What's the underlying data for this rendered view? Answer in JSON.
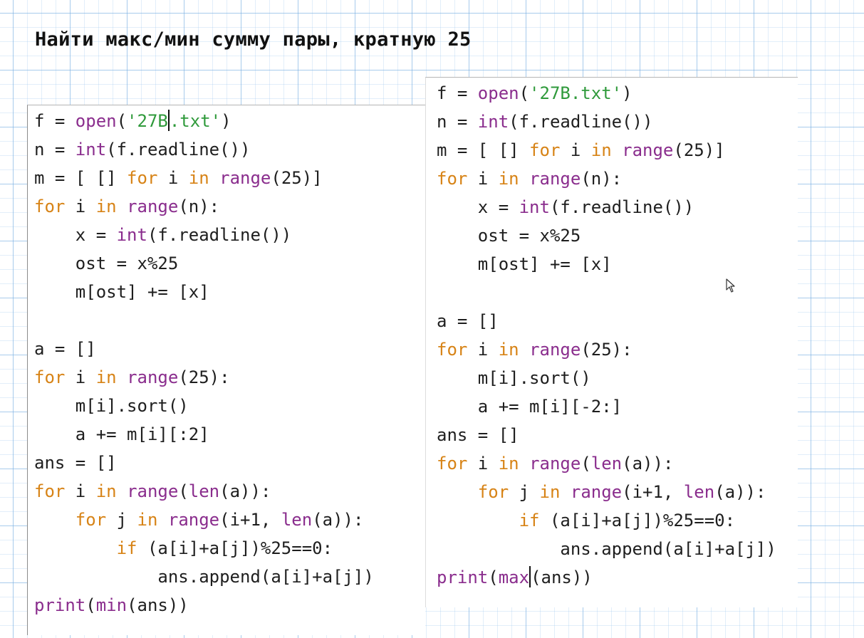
{
  "title": "Найти макс/мин сумму пары, кратную 25",
  "colors": {
    "keyword": "#d78316",
    "builtin": "#8a2d8d",
    "string": "#2f9a3b",
    "text": "#1e1e1e",
    "grid": "#78afe1"
  },
  "left_code": {
    "lines": [
      [
        {
          "t": "f = ",
          "c": "pl"
        },
        {
          "t": "open",
          "c": "bi"
        },
        {
          "t": "(",
          "c": "pl"
        },
        {
          "t": "'27B",
          "c": "str"
        },
        {
          "cursor": true
        },
        {
          "t": ".txt'",
          "c": "str"
        },
        {
          "t": ")",
          "c": "pl"
        }
      ],
      [
        {
          "t": "n = ",
          "c": "pl"
        },
        {
          "t": "int",
          "c": "bi"
        },
        {
          "t": "(f.readline())",
          "c": "pl"
        }
      ],
      [
        {
          "t": "m = [ [] ",
          "c": "pl"
        },
        {
          "t": "for",
          "c": "kw"
        },
        {
          "t": " i ",
          "c": "pl"
        },
        {
          "t": "in",
          "c": "kw"
        },
        {
          "t": " ",
          "c": "pl"
        },
        {
          "t": "range",
          "c": "bi"
        },
        {
          "t": "(25)]",
          "c": "pl"
        }
      ],
      [
        {
          "t": "for",
          "c": "kw"
        },
        {
          "t": " i ",
          "c": "pl"
        },
        {
          "t": "in",
          "c": "kw"
        },
        {
          "t": " ",
          "c": "pl"
        },
        {
          "t": "range",
          "c": "bi"
        },
        {
          "t": "(n):",
          "c": "pl"
        }
      ],
      [
        {
          "t": "    x = ",
          "c": "pl"
        },
        {
          "t": "int",
          "c": "bi"
        },
        {
          "t": "(f.readline())",
          "c": "pl"
        }
      ],
      [
        {
          "t": "    ost = x%25",
          "c": "pl"
        }
      ],
      [
        {
          "t": "    m[ost] += [x]",
          "c": "pl"
        }
      ],
      [],
      [
        {
          "t": "a = []",
          "c": "pl"
        }
      ],
      [
        {
          "t": "for",
          "c": "kw"
        },
        {
          "t": " i ",
          "c": "pl"
        },
        {
          "t": "in",
          "c": "kw"
        },
        {
          "t": " ",
          "c": "pl"
        },
        {
          "t": "range",
          "c": "bi"
        },
        {
          "t": "(25):",
          "c": "pl"
        }
      ],
      [
        {
          "t": "    m[i].sort()",
          "c": "pl"
        }
      ],
      [
        {
          "t": "    a += m[i][:2]",
          "c": "pl"
        }
      ],
      [
        {
          "t": "ans = []",
          "c": "pl"
        }
      ],
      [
        {
          "t": "for",
          "c": "kw"
        },
        {
          "t": " i ",
          "c": "pl"
        },
        {
          "t": "in",
          "c": "kw"
        },
        {
          "t": " ",
          "c": "pl"
        },
        {
          "t": "range",
          "c": "bi"
        },
        {
          "t": "(",
          "c": "pl"
        },
        {
          "t": "len",
          "c": "bi"
        },
        {
          "t": "(a)):",
          "c": "pl"
        }
      ],
      [
        {
          "t": "    ",
          "c": "pl"
        },
        {
          "t": "for",
          "c": "kw"
        },
        {
          "t": " j ",
          "c": "pl"
        },
        {
          "t": "in",
          "c": "kw"
        },
        {
          "t": " ",
          "c": "pl"
        },
        {
          "t": "range",
          "c": "bi"
        },
        {
          "t": "(i+1, ",
          "c": "pl"
        },
        {
          "t": "len",
          "c": "bi"
        },
        {
          "t": "(a)):",
          "c": "pl"
        }
      ],
      [
        {
          "t": "        ",
          "c": "pl"
        },
        {
          "t": "if",
          "c": "kw"
        },
        {
          "t": " (a[i]+a[j])%25==0:",
          "c": "pl"
        }
      ],
      [
        {
          "t": "            ans.append(a[i]+a[j])",
          "c": "pl"
        }
      ],
      [
        {
          "t": "print",
          "c": "bi"
        },
        {
          "t": "(",
          "c": "pl"
        },
        {
          "t": "min",
          "c": "bi"
        },
        {
          "t": "(ans))",
          "c": "pl"
        }
      ]
    ]
  },
  "right_code": {
    "lines": [
      [
        {
          "t": "f = ",
          "c": "pl"
        },
        {
          "t": "open",
          "c": "bi"
        },
        {
          "t": "(",
          "c": "pl"
        },
        {
          "t": "'27B.txt'",
          "c": "str"
        },
        {
          "t": ")",
          "c": "pl"
        }
      ],
      [
        {
          "t": "n = ",
          "c": "pl"
        },
        {
          "t": "int",
          "c": "bi"
        },
        {
          "t": "(f.readline())",
          "c": "pl"
        }
      ],
      [
        {
          "t": "m = [ [] ",
          "c": "pl"
        },
        {
          "t": "for",
          "c": "kw"
        },
        {
          "t": " i ",
          "c": "pl"
        },
        {
          "t": "in",
          "c": "kw"
        },
        {
          "t": " ",
          "c": "pl"
        },
        {
          "t": "range",
          "c": "bi"
        },
        {
          "t": "(25)]",
          "c": "pl"
        }
      ],
      [
        {
          "t": "for",
          "c": "kw"
        },
        {
          "t": " i ",
          "c": "pl"
        },
        {
          "t": "in",
          "c": "kw"
        },
        {
          "t": " ",
          "c": "pl"
        },
        {
          "t": "range",
          "c": "bi"
        },
        {
          "t": "(n):",
          "c": "pl"
        }
      ],
      [
        {
          "t": "    x = ",
          "c": "pl"
        },
        {
          "t": "int",
          "c": "bi"
        },
        {
          "t": "(f.readline())",
          "c": "pl"
        }
      ],
      [
        {
          "t": "    ost = x%25",
          "c": "pl"
        }
      ],
      [
        {
          "t": "    m[ost] += [x]",
          "c": "pl"
        }
      ],
      [],
      [
        {
          "t": "a = []",
          "c": "pl"
        }
      ],
      [
        {
          "t": "for",
          "c": "kw"
        },
        {
          "t": " i ",
          "c": "pl"
        },
        {
          "t": "in",
          "c": "kw"
        },
        {
          "t": " ",
          "c": "pl"
        },
        {
          "t": "range",
          "c": "bi"
        },
        {
          "t": "(25):",
          "c": "pl"
        }
      ],
      [
        {
          "t": "    m[i].sort()",
          "c": "pl"
        }
      ],
      [
        {
          "t": "    a += m[i][-2:]",
          "c": "pl"
        }
      ],
      [
        {
          "t": "ans = []",
          "c": "pl"
        }
      ],
      [
        {
          "t": "for",
          "c": "kw"
        },
        {
          "t": " i ",
          "c": "pl"
        },
        {
          "t": "in",
          "c": "kw"
        },
        {
          "t": " ",
          "c": "pl"
        },
        {
          "t": "range",
          "c": "bi"
        },
        {
          "t": "(",
          "c": "pl"
        },
        {
          "t": "len",
          "c": "bi"
        },
        {
          "t": "(a)):",
          "c": "pl"
        }
      ],
      [
        {
          "t": "    ",
          "c": "pl"
        },
        {
          "t": "for",
          "c": "kw"
        },
        {
          "t": " j ",
          "c": "pl"
        },
        {
          "t": "in",
          "c": "kw"
        },
        {
          "t": " ",
          "c": "pl"
        },
        {
          "t": "range",
          "c": "bi"
        },
        {
          "t": "(i+1, ",
          "c": "pl"
        },
        {
          "t": "len",
          "c": "bi"
        },
        {
          "t": "(a)):",
          "c": "pl"
        }
      ],
      [
        {
          "t": "        ",
          "c": "pl"
        },
        {
          "t": "if",
          "c": "kw"
        },
        {
          "t": " (a[i]+a[j])%25==0:",
          "c": "pl"
        }
      ],
      [
        {
          "t": "            ans.append(a[i]+a[j])",
          "c": "pl"
        }
      ],
      [
        {
          "t": "print",
          "c": "bi"
        },
        {
          "t": "(",
          "c": "pl"
        },
        {
          "t": "max",
          "c": "bi"
        },
        {
          "cursor": true
        },
        {
          "t": "(ans))",
          "c": "pl"
        }
      ]
    ]
  }
}
